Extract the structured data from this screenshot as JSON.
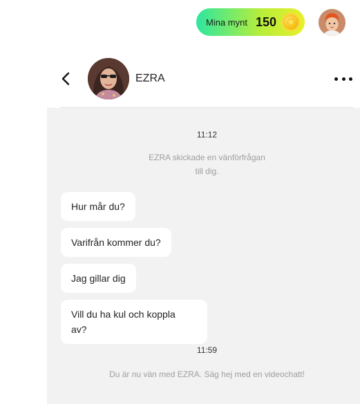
{
  "header": {
    "coins_label": "Mina mynt",
    "coins_value": "150",
    "coin_icon": "coin-icon",
    "avatar_icon": "user-avatar"
  },
  "chat": {
    "contact_name": "EZRA",
    "back_icon": "chevron-left-icon",
    "more_icon": "more-horizontal-icon",
    "timestamps": [
      "11:12",
      "11:59"
    ],
    "system_messages": [
      {
        "line1": "EZRA skickade en vänförfrågan",
        "line2": "till dig."
      },
      {
        "line1": "Du är nu vän med EZRA. Säg hej med en videochatt!"
      }
    ],
    "messages": [
      {
        "text": "Hur mår du?"
      },
      {
        "text": "Varifrån kommer du?"
      },
      {
        "text": "Jag gillar dig"
      },
      {
        "line1": "Vill du ha kul och koppla",
        "line2": "av?"
      }
    ]
  },
  "colors": {
    "pill_gradient": [
      "#2ee6a0",
      "#e9ef2a"
    ],
    "chat_bg": "#f2f2f2",
    "bubble_bg": "#ffffff",
    "system_text": "#9e9e9e"
  }
}
